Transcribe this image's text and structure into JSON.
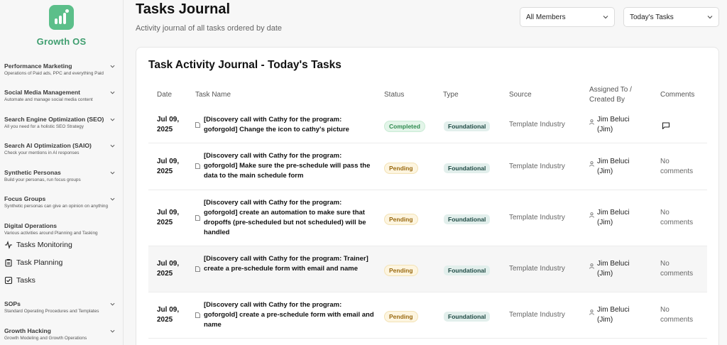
{
  "sidebar": {
    "brand": "Growth OS",
    "sections": [
      {
        "title": "Performance Marketing",
        "subtitle": "Operations of Paid ads, PPC and everything Paid"
      },
      {
        "title": "Social Media Management",
        "subtitle": "Automate and manage social media content"
      },
      {
        "title": "Search Engine Optimization (SEO)",
        "subtitle": "All you need for a holistic SEO Strategy"
      },
      {
        "title": "Search AI Optimization (SAIO)",
        "subtitle": "Check your mentions in AI responses"
      },
      {
        "title": "Synthetic Personas",
        "subtitle": "Build your personas, run focus groups"
      },
      {
        "title": "Focus Groups",
        "subtitle": "Synthetic personas can give an opinion on anything"
      },
      {
        "title": "Digital Operations",
        "subtitle": "Various activities around Planning and Tasking"
      },
      {
        "title": "SOPs",
        "subtitle": "Standard Operating Procedures and Templates"
      },
      {
        "title": "Growth Hacking",
        "subtitle": "Growth Modeling and Growth Operations"
      }
    ],
    "digital_ops_items": [
      "Tasks Monitoring",
      "Task Planning",
      "Tasks"
    ]
  },
  "header": {
    "title": "Tasks Journal",
    "subtitle": "Activity journal of all tasks ordered by date",
    "member_filter": "All Members",
    "task_filter": "Today's Tasks"
  },
  "card": {
    "title": "Task Activity Journal - Today's Tasks",
    "columns": [
      "Date",
      "Task Name",
      "Status",
      "Type",
      "Source",
      "Assigned To /",
      "Created By",
      "Comments"
    ]
  },
  "rows": [
    {
      "date_line1": "Jul 09,",
      "date_line2": "2025",
      "task": "[Discovery call with Cathy for the program: goforgold] Change the icon to cathy's picture",
      "status": "Completed",
      "type": "Foundational",
      "source": "Template Industry",
      "assignee_line1": "Jim Beluci",
      "assignee_line2": "(Jim)",
      "comments": ""
    },
    {
      "date_line1": "Jul 09,",
      "date_line2": "2025",
      "task": "[Discovery call with Cathy for the program: goforgold] Make sure the pre-schedule will pass the data to the main schedule form",
      "status": "Pending",
      "type": "Foundational",
      "source": "Template Industry",
      "assignee_line1": "Jim Beluci",
      "assignee_line2": "(Jim)",
      "comments": "No comments"
    },
    {
      "date_line1": "Jul 09,",
      "date_line2": "2025",
      "task": "[Discovery call with Cathy for the program: goforgold] create an automation to make sure that dropoffs (pre-scheduled but not scheduled) will be handled",
      "status": "Pending",
      "type": "Foundational",
      "source": "Template Industry",
      "assignee_line1": "Jim Beluci",
      "assignee_line2": "(Jim)",
      "comments": "No comments"
    },
    {
      "date_line1": "Jul 09,",
      "date_line2": "2025",
      "task": "[Discovery call with Cathy for the program: Trainer] create a pre-schedule form with email and name",
      "status": "Pending",
      "type": "Foundational",
      "source": "Template Industry",
      "assignee_line1": "Jim Beluci",
      "assignee_line2": "(Jim)",
      "comments": "No comments"
    },
    {
      "date_line1": "Jul 09,",
      "date_line2": "2025",
      "task": "[Discovery call with Cathy for the program: goforgold] create a pre-schedule form with email and name",
      "status": "Pending",
      "type": "Foundational",
      "source": "Template Industry",
      "assignee_line1": "Jim Beluci",
      "assignee_line2": "(Jim)",
      "comments": "No comments"
    }
  ],
  "colors": {
    "brand": "#3f9e6f",
    "logo_bg": "#5cbf8a",
    "completed": "#2f8a4f",
    "pending": "#9a6a10",
    "type_bg": "#e2efec"
  },
  "icons": {
    "logo": "bar-chart-icon",
    "chevron": "chevron-down-icon",
    "task": "document-icon",
    "user": "user-icon",
    "comment": "message-square-icon",
    "monitoring": "activity-icon",
    "planning": "clipboard-icon",
    "tasks": "checkbox-icon"
  }
}
